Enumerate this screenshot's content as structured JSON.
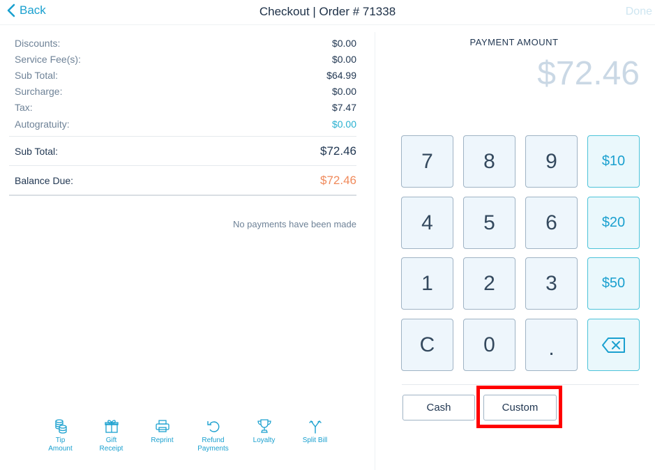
{
  "header": {
    "back_label": "Back",
    "title": "Checkout | Order # 71338",
    "done_label": "Done"
  },
  "summary": {
    "lines": [
      {
        "label": "Discounts:",
        "value": "$0.00"
      },
      {
        "label": "Service Fee(s):",
        "value": "$0.00"
      },
      {
        "label": "Sub Total:",
        "value": "$64.99"
      },
      {
        "label": "Surcharge:",
        "value": "$0.00"
      },
      {
        "label": "Tax:",
        "value": "$7.47"
      },
      {
        "label": "Autogratuity:",
        "value": "$0.00"
      }
    ],
    "subtotal_label": "Sub Total:",
    "subtotal_value": "$72.46",
    "balance_label": "Balance Due:",
    "balance_value": "$72.46",
    "no_payments": "No payments have been made"
  },
  "toolbar": {
    "items": [
      {
        "line1": "Tip",
        "line2": "Amount",
        "icon": "coins-icon"
      },
      {
        "line1": "Gift",
        "line2": "Receipt",
        "icon": "gift-icon"
      },
      {
        "line1": "Reprint",
        "line2": "",
        "icon": "printer-icon"
      },
      {
        "line1": "Refund",
        "line2": "Payments",
        "icon": "undo-icon"
      },
      {
        "line1": "Loyalty",
        "line2": "",
        "icon": "trophy-icon"
      },
      {
        "line1": "Split Bill",
        "line2": "",
        "icon": "split-icon"
      }
    ]
  },
  "payment": {
    "label": "PAYMENT AMOUNT",
    "amount": "$72.46"
  },
  "keypad": {
    "keys": [
      "7",
      "8",
      "9",
      "$10",
      "4",
      "5",
      "6",
      "$20",
      "1",
      "2",
      "3",
      "$50",
      "C",
      "0",
      "."
    ],
    "backspace_icon": "backspace-icon"
  },
  "buttons": {
    "cash_label": "Cash",
    "custom_label": "Custom"
  },
  "colors": {
    "accent": "#1aa0cf",
    "balance": "#f08a5b",
    "highlight": "#ff0000"
  }
}
